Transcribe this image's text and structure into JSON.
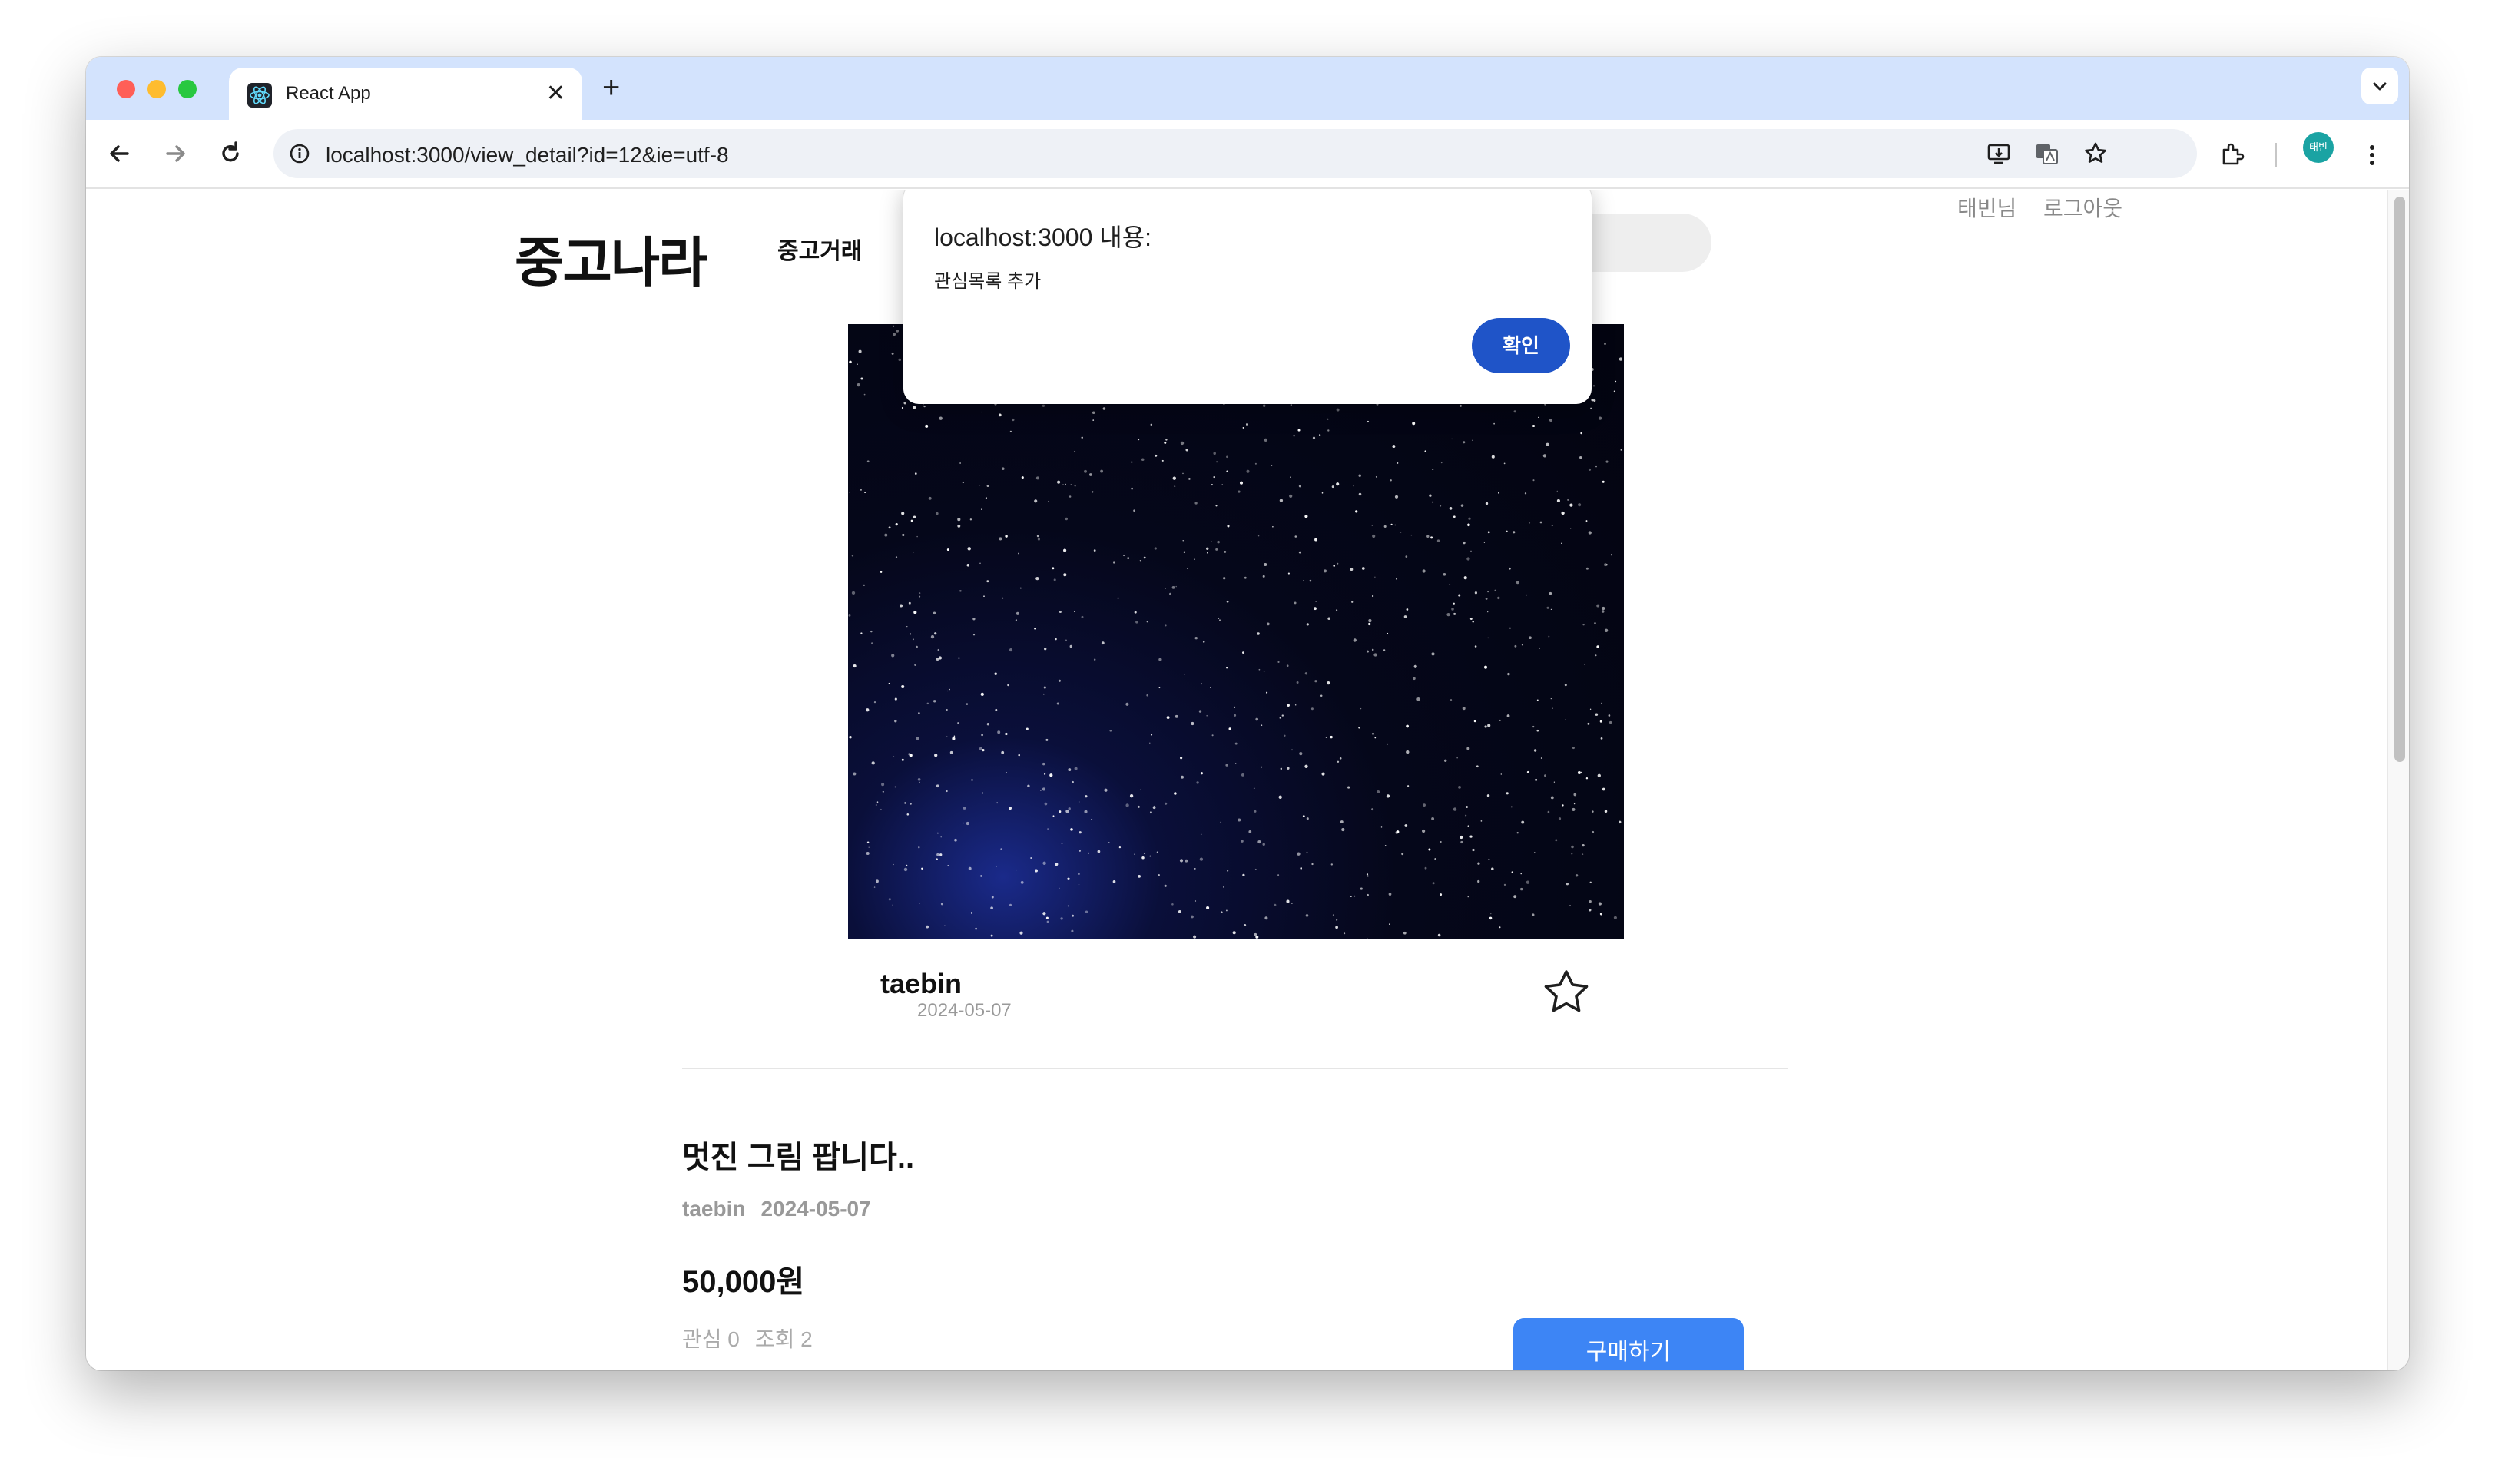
{
  "browser": {
    "tab_title": "React App",
    "tab_close": "✕",
    "new_tab": "+",
    "url": "localhost:3000/view_detail?id=12&ie=utf-8",
    "profile_initials": "태빈"
  },
  "header": {
    "logo": "중고나라",
    "nav_link": "중고거래",
    "user_name": "태빈님",
    "logout": "로그아웃"
  },
  "product": {
    "seller": "taebin",
    "seller_date": "2024-05-07",
    "title": "멋진 그림 팝니다..",
    "meta_seller": "taebin",
    "meta_date": "2024-05-07",
    "price": "50,000원",
    "interest": "관심 0",
    "views": "조회 2",
    "buy_label": "구매하기"
  },
  "dialog": {
    "title": "localhost:3000 내용:",
    "message": "관심목록 추가",
    "ok_label": "확인"
  },
  "colors": {
    "tabstrip": "#d3e3fd",
    "primary_button": "#3d85f5",
    "dialog_button": "#1f54c8"
  }
}
